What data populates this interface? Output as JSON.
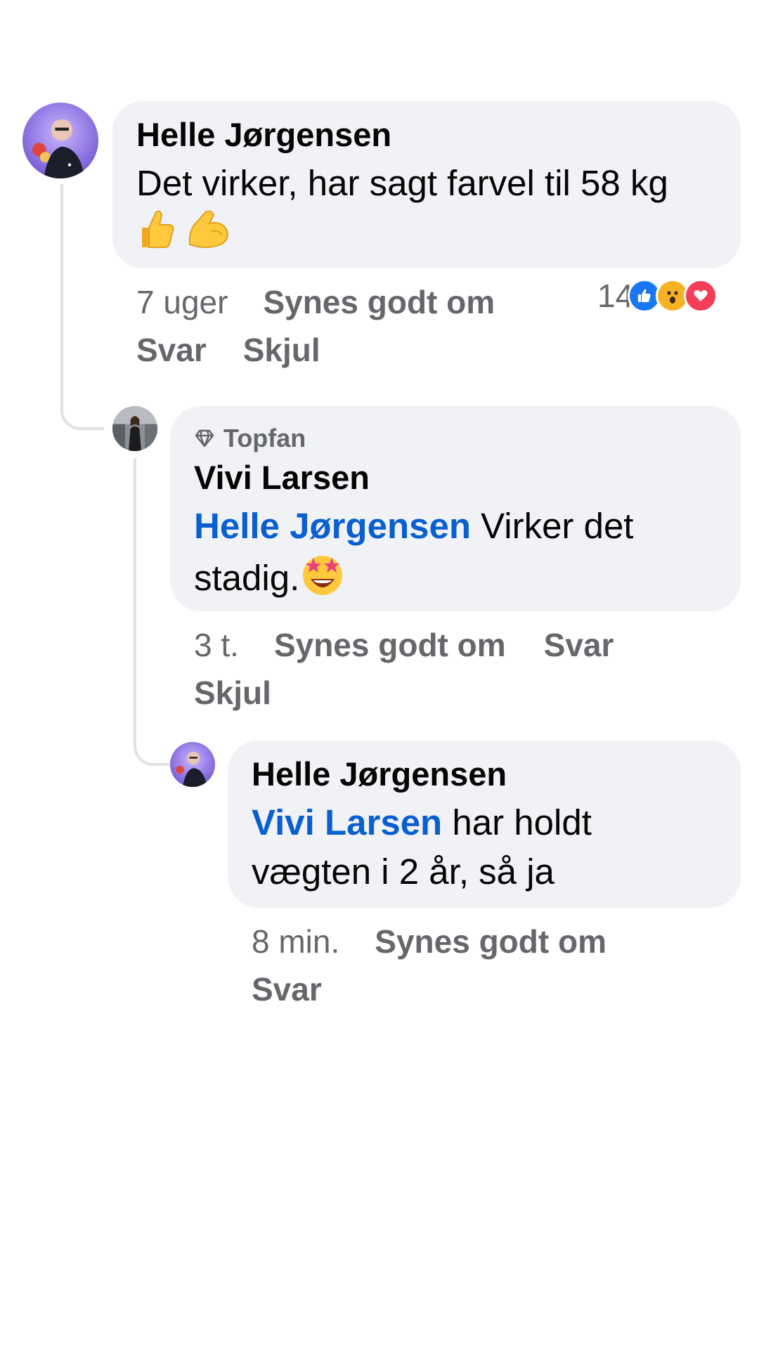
{
  "comments": [
    {
      "author": "Helle Jørgensen",
      "text": "Det virker, har sagt farvel til 58 kg",
      "time": "7 uger",
      "like_label": "Synes godt om",
      "reply_label": "Svar",
      "hide_label": "Skjul",
      "reaction_count": "14",
      "reaction_icons": [
        "like-icon",
        "wow-icon",
        "love-icon"
      ]
    }
  ],
  "replies": [
    {
      "badge": "Topfan",
      "author": "Vivi Larsen",
      "mention": "Helle Jørgensen",
      "text": "Virker det stadig.",
      "time": "3 t.",
      "like_label": "Synes godt om",
      "reply_label": "Svar",
      "hide_label": "Skjul"
    },
    {
      "author": "Helle Jørgensen",
      "mention": "Vivi Larsen",
      "text": "har holdt vægten i 2 år, så ja",
      "time": "8 min.",
      "like_label": "Synes godt om",
      "reply_label": "Svar"
    }
  ],
  "colors": {
    "bubble": "#f0f2f5",
    "mention": "#0a5fd0",
    "meta": "#65676b",
    "like": "#1877f2",
    "love": "#f33e58",
    "wow": "#f7b125"
  }
}
